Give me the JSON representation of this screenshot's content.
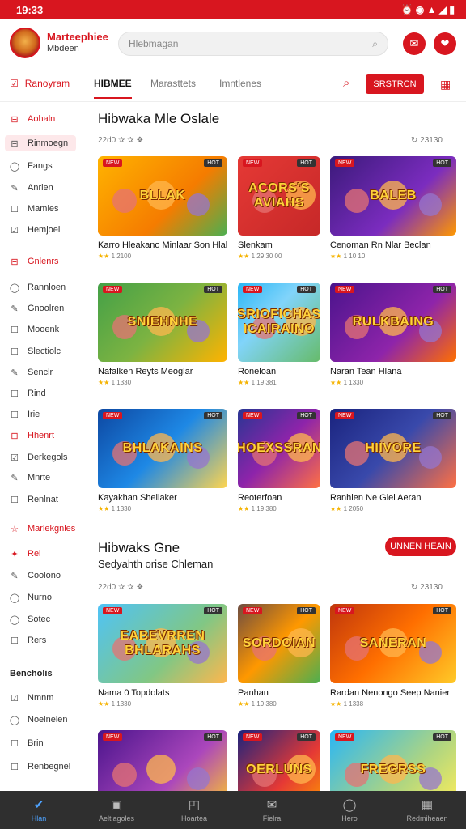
{
  "status_bar": {
    "time": "19:33",
    "icons": "⏰ ◉ ▲ ◢ ▮"
  },
  "header": {
    "brand_line1": "Marteephiee",
    "brand_line2": "Mbdeen",
    "search_placeholder": "Hlebmagan"
  },
  "tabs": {
    "left_label": "Ranoyram",
    "items": [
      "HIBMEE",
      "Marasttets",
      "Imntlenes"
    ],
    "action_button": "SRSTRCN"
  },
  "sidebar": {
    "items": [
      {
        "label": "Aohaln",
        "icon": "⊟",
        "style": "red"
      },
      {
        "label": "Rinmoegn",
        "icon": "⊟",
        "style": "sel"
      },
      {
        "label": "Fangs",
        "icon": "◯",
        "style": ""
      },
      {
        "label": "Anrlen",
        "icon": "✎",
        "style": ""
      },
      {
        "label": "Mamles",
        "icon": "☐",
        "style": ""
      },
      {
        "label": "Hemjoel",
        "icon": "☑",
        "style": ""
      },
      {
        "label": "Gnlenrs",
        "icon": "⊟",
        "style": "red"
      },
      {
        "label": "Rannloen",
        "icon": "◯",
        "style": ""
      },
      {
        "label": "Gnoolren",
        "icon": "✎",
        "style": ""
      },
      {
        "label": "Mooenk",
        "icon": "☐",
        "style": ""
      },
      {
        "label": "Slectiolc",
        "icon": "☐",
        "style": ""
      },
      {
        "label": "Senclr",
        "icon": "✎",
        "style": ""
      },
      {
        "label": "Rind",
        "icon": "☐",
        "style": ""
      },
      {
        "label": "Irie",
        "icon": "☐",
        "style": ""
      },
      {
        "label": "Hhenrt",
        "icon": "⊟",
        "style": "red"
      },
      {
        "label": "Derkegols",
        "icon": "☑",
        "style": ""
      },
      {
        "label": "Mnrte",
        "icon": "✎",
        "style": ""
      },
      {
        "label": "Renlnat",
        "icon": "☐",
        "style": ""
      },
      {
        "label": "Marlekgnles",
        "icon": "☆",
        "style": "red"
      },
      {
        "label": "Rei",
        "icon": "✦",
        "style": "red"
      },
      {
        "label": "Coolono",
        "icon": "✎",
        "style": ""
      },
      {
        "label": "Nurno",
        "icon": "◯",
        "style": ""
      },
      {
        "label": "Sotec",
        "icon": "◯",
        "style": ""
      },
      {
        "label": "Rers",
        "icon": "☐",
        "style": ""
      },
      {
        "label": "Bencholis",
        "icon": "",
        "style": "head"
      },
      {
        "label": "Nmnm",
        "icon": "☑",
        "style": ""
      },
      {
        "label": "Noelnelen",
        "icon": "◯",
        "style": ""
      },
      {
        "label": "Brin",
        "icon": "☐",
        "style": ""
      },
      {
        "label": "Renbegnel",
        "icon": "☐",
        "style": ""
      }
    ]
  },
  "section1": {
    "title": "Hibwaka Mle Oslale",
    "meta_left": "22d0 ✰ ✰ ❖",
    "meta_right": "↻   23130",
    "cards": [
      {
        "title": "Karro Hleakano Minlaar Son Hlala",
        "rating": "1 2100",
        "art": "BLLAK",
        "bg": "linear-gradient(135deg,#ffb300,#f57c00 60%,#4caf50)"
      },
      {
        "title": "Slenkam",
        "rating": "1 29 30 00",
        "art": "ACORS'S AVIAHS",
        "bg": "linear-gradient(135deg,#e53935,#c62828)"
      },
      {
        "title": "Cenoman Rn Nlar Beclan",
        "rating": "1 10 10",
        "art": "BALEB",
        "bg": "linear-gradient(135deg,#3b1a7a,#7b2cbf 60%,#ff9800)"
      },
      {
        "title": "Nafalken Reyts Meoglar",
        "rating": "1 1330",
        "art": "SNIEHNHE",
        "bg": "linear-gradient(135deg,#43a047,#7cb342 50%,#ffb300)"
      },
      {
        "title": "Roneloan",
        "rating": "1 19 381",
        "art": "SRIOFICHAS ICAIRAINO",
        "bg": "linear-gradient(135deg,#29b6f6,#81d4fa 40%,#66bb6a)"
      },
      {
        "title": "Naran Tean Hlana",
        "rating": "1 1330",
        "art": "RULKBAING",
        "bg": "linear-gradient(135deg,#4a148c,#8e24aa 60%,#ff6f00)"
      },
      {
        "title": "Kayakhan Sheliaker",
        "rating": "1 1330",
        "art": "BHLAKAINS",
        "bg": "linear-gradient(135deg,#0d47a1,#1e88e5 50%,#ffd54f)"
      },
      {
        "title": "Reoterfoan",
        "rating": "1 19 380",
        "art": "HOEXSSRAN",
        "bg": "linear-gradient(135deg,#283593,#8e24aa 50%,#ff7043)"
      },
      {
        "title": "Ranhlen Ne Glel Aeran",
        "rating": "1 2050",
        "art": "HIIVORE",
        "bg": "linear-gradient(135deg,#1a237e,#3949ab 50%,#ff7043)"
      }
    ]
  },
  "section2": {
    "title": "Hibwaks Gne",
    "subtitle": "Sedyahth orise Chleman",
    "more_button": "UNNEN HEAIN",
    "meta_left": "22d0 ✰ ✰ ❖",
    "meta_right": "↻   23130",
    "cards": [
      {
        "title": "Nama 0 Topdolats",
        "rating": "1 1330",
        "art": "EABEVRREN BHLARAHS",
        "bg": "linear-gradient(135deg,#4fc3f7,#81c784 60%,#ffb74d)"
      },
      {
        "title": "Panhan",
        "rating": "1 19 380",
        "art": "SORDOIAN",
        "bg": "linear-gradient(135deg,#6d4c41,#ff9800 50%,#4caf50)"
      },
      {
        "title": "Rardan Nenongo Seep Nanier",
        "rating": "1 1338",
        "art": "SANERAN",
        "bg": "linear-gradient(135deg,#bf360c,#ff6f00 50%,#ffca28)"
      },
      {
        "title": "",
        "rating": "",
        "art": "",
        "bg": "linear-gradient(135deg,#4a148c,#ab47bc 60%,#ffca28)"
      },
      {
        "title": "",
        "rating": "",
        "art": "OERLUNS",
        "bg": "linear-gradient(135deg,#1a237e,#e53935 60%,#ff9800)"
      },
      {
        "title": "",
        "rating": "",
        "art": "FREGRSS",
        "bg": "linear-gradient(135deg,#29b6f6,#aed581 60%,#ffee58)"
      }
    ]
  },
  "bottom_nav": [
    {
      "label": "Hlan",
      "icon": "✔",
      "active": true
    },
    {
      "label": "Aeltlagoles",
      "icon": "▣",
      "active": false
    },
    {
      "label": "Hoartea",
      "icon": "◰",
      "active": false
    },
    {
      "label": "Fielra",
      "icon": "✉",
      "active": false
    },
    {
      "label": "Hero",
      "icon": "◯",
      "active": false
    },
    {
      "label": "Redmiheaen",
      "icon": "▦",
      "active": false
    }
  ]
}
